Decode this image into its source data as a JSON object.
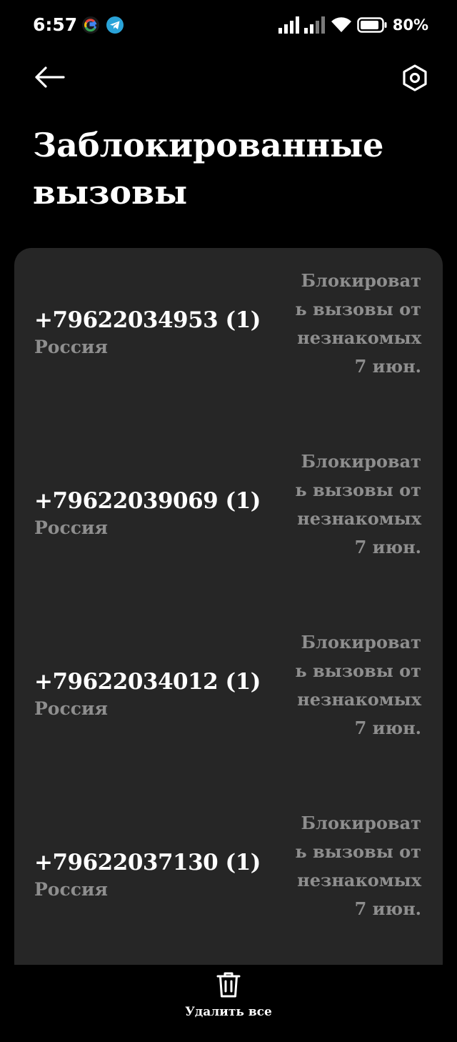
{
  "status_bar": {
    "time": "6:57",
    "battery_percent": "80%",
    "app_icons": [
      "google-icon",
      "telegram-icon"
    ]
  },
  "top_bar": {
    "back_icon": "arrow-left-icon",
    "settings_icon": "settings-icon"
  },
  "page": {
    "title": "Заблокированные вызовы"
  },
  "blocked_calls": [
    {
      "number": "+79622034953 (1)",
      "country": "Россия",
      "reason": "Блокировать вызовы от незнакомых",
      "date": "7 июн."
    },
    {
      "number": "+79622039069 (1)",
      "country": "Россия",
      "reason": "Блокировать вызовы от незнакомых",
      "date": "7 июн."
    },
    {
      "number": "+79622034012 (1)",
      "country": "Россия",
      "reason": "Блокировать вызовы от незнакомых",
      "date": "7 июн."
    },
    {
      "number": "+79622037130 (1)",
      "country": "Россия",
      "reason": "Блокировать вызовы от незнакомых",
      "date": "7 июн."
    }
  ],
  "bottom_action": {
    "label": "Удалить все",
    "icon": "trash-icon"
  },
  "colors": {
    "background": "#000000",
    "card": "#262626",
    "primary_text": "#ffffff",
    "secondary_text": "#8e8e8e"
  }
}
